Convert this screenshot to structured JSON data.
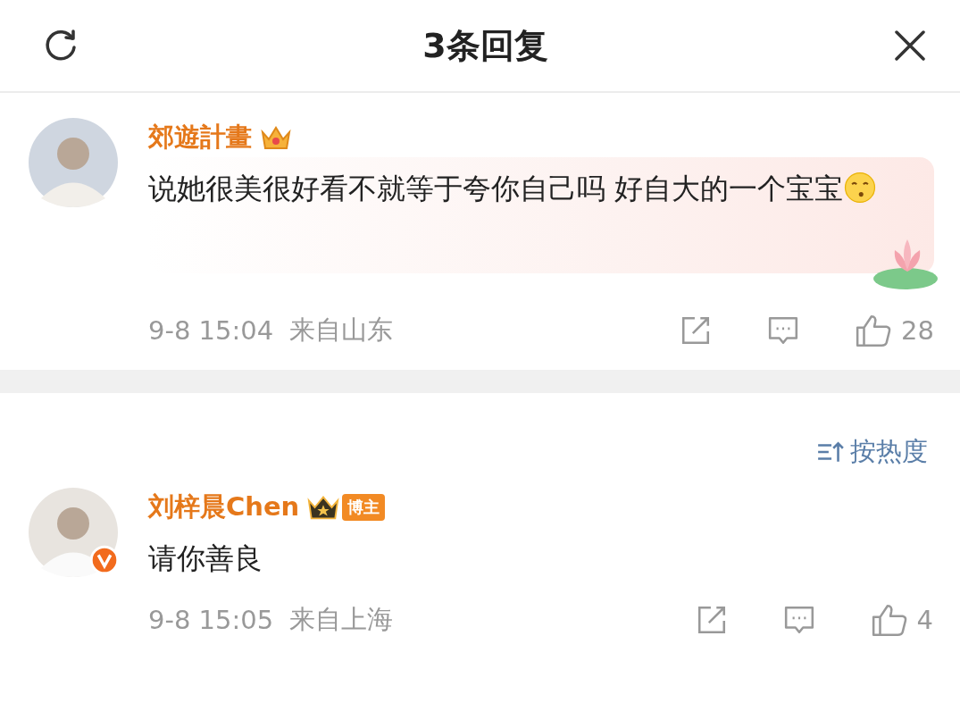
{
  "header": {
    "title": "3条回复"
  },
  "root_comment": {
    "user": "郊遊計畫",
    "crown_star": false,
    "bubble": true,
    "verified": false,
    "text": "说她很美很好看不就等于夸你自己吗 好自大的一个宝宝",
    "emoji": true,
    "time": "9-8 15:04",
    "location": "来自山东",
    "likes": "28"
  },
  "sort": {
    "label": "按热度"
  },
  "replies": [
    {
      "user": "刘梓晨Chen",
      "crown_star": true,
      "role_tag": "博主",
      "bubble": false,
      "verified": true,
      "text": "请你善良",
      "emoji": false,
      "time": "9-8 15:05",
      "location": "来自上海",
      "likes": "4"
    }
  ]
}
